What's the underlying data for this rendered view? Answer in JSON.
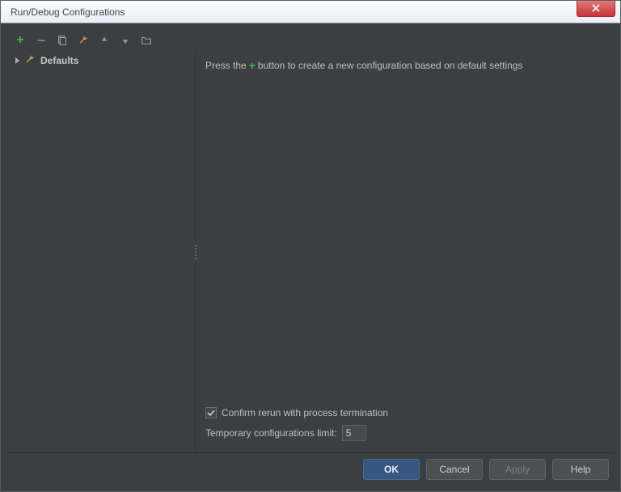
{
  "window": {
    "title": "Run/Debug Configurations"
  },
  "sidebar": {
    "defaults_label": "Defaults"
  },
  "hint": {
    "prefix": "Press the",
    "plus": "+",
    "suffix": "button to create a new configuration based on default settings"
  },
  "options": {
    "confirm_rerun_label": "Confirm rerun with process termination",
    "confirm_rerun_checked": true,
    "temp_limit_label": "Temporary configurations limit:",
    "temp_limit_value": "5"
  },
  "buttons": {
    "ok": "OK",
    "cancel": "Cancel",
    "apply": "Apply",
    "help": "Help"
  }
}
